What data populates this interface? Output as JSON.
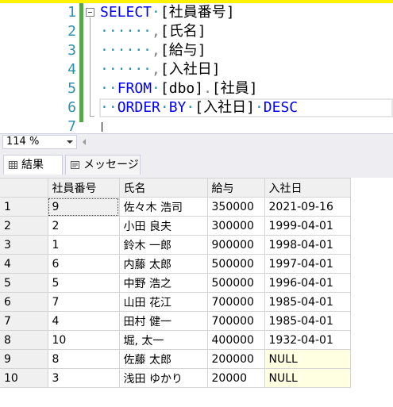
{
  "editor": {
    "line_numbers": [
      "1",
      "2",
      "3",
      "4",
      "5",
      "6",
      "7"
    ],
    "lines": [
      [
        {
          "t": "SELECT",
          "c": "kw"
        },
        {
          "t": "·",
          "c": "ws"
        },
        {
          "t": "[社員番号]",
          "c": ""
        }
      ],
      [
        {
          "t": "······",
          "c": "ws"
        },
        {
          "t": ",",
          "c": "gr"
        },
        {
          "t": "[氏名]",
          "c": ""
        }
      ],
      [
        {
          "t": "······",
          "c": "ws"
        },
        {
          "t": ",",
          "c": "gr"
        },
        {
          "t": "[給与]",
          "c": ""
        }
      ],
      [
        {
          "t": "······",
          "c": "ws"
        },
        {
          "t": ",",
          "c": "gr"
        },
        {
          "t": "[入社日]",
          "c": ""
        }
      ],
      [
        {
          "t": "··",
          "c": "ws"
        },
        {
          "t": "FROM",
          "c": "kw"
        },
        {
          "t": "·",
          "c": "ws"
        },
        {
          "t": "[dbo]",
          "c": ""
        },
        {
          "t": ".",
          "c": "gr"
        },
        {
          "t": "[社員]",
          "c": ""
        }
      ],
      [
        {
          "t": "··",
          "c": "ws"
        },
        {
          "t": "ORDER",
          "c": "kw"
        },
        {
          "t": "·",
          "c": "ws"
        },
        {
          "t": "BY",
          "c": "kw"
        },
        {
          "t": "·",
          "c": "ws"
        },
        {
          "t": "[入社日]",
          "c": ""
        },
        {
          "t": "·",
          "c": "ws"
        },
        {
          "t": "DESC",
          "c": "kw"
        }
      ],
      []
    ],
    "colors": {
      "keyword": "#0000ff",
      "line_number": "#2b91af",
      "change_bar": "#57a64a",
      "top_strip": "#fff200"
    }
  },
  "status": {
    "zoom": "114 %"
  },
  "tabs": {
    "results_label": "結果",
    "messages_label": "メッセージ"
  },
  "grid": {
    "columns": [
      "",
      "社員番号",
      "氏名",
      "給与",
      "入社日"
    ],
    "rows": [
      [
        "1",
        "9",
        "佐々木 浩司",
        "350000",
        "2021-09-16"
      ],
      [
        "2",
        "2",
        "小田 良夫",
        "300000",
        "1999-04-01"
      ],
      [
        "3",
        "1",
        "鈴木 一郎",
        "900000",
        "1998-04-01"
      ],
      [
        "4",
        "6",
        "内藤 太郎",
        "500000",
        "1997-04-01"
      ],
      [
        "5",
        "5",
        "中野 浩之",
        "500000",
        "1996-04-01"
      ],
      [
        "6",
        "7",
        "山田 花江",
        "700000",
        "1985-04-01"
      ],
      [
        "7",
        "4",
        "田村 健一",
        "700000",
        "1985-04-01"
      ],
      [
        "8",
        "10",
        "堀, 太一",
        "400000",
        "1932-04-01"
      ],
      [
        "9",
        "8",
        "佐藤 太郎",
        "200000",
        "NULL"
      ],
      [
        "10",
        "3",
        "浅田 ゆかり",
        "20000",
        "NULL"
      ]
    ]
  }
}
